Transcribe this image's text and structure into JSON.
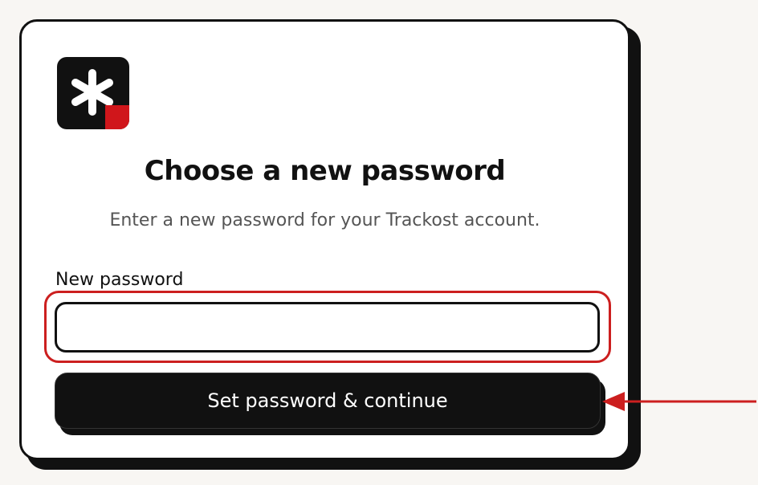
{
  "card": {
    "title": "Choose a new password",
    "subtitle": "Enter a new password for your Trackost account.",
    "field": {
      "label": "New password",
      "value": "",
      "placeholder": ""
    },
    "submit_label": "Set password & continue"
  },
  "logo": {
    "icon": "asterisk-icon",
    "background": "#111111",
    "accent": "#d0161b"
  },
  "annotations": {
    "highlight_color": "#cc1f1f",
    "arrow_color": "#cc1f1f"
  }
}
